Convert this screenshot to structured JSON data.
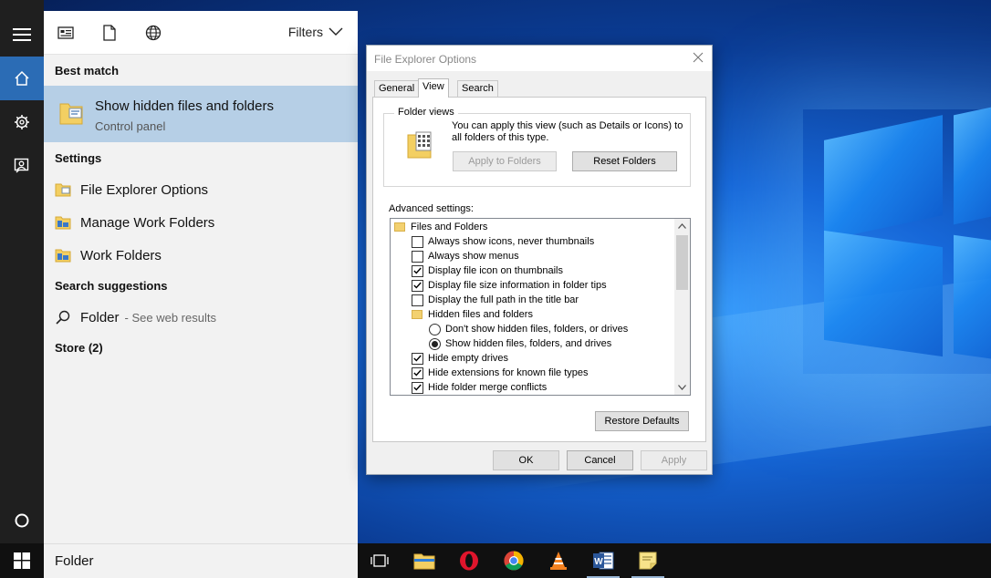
{
  "start_rail": {
    "items": [
      {
        "icon": "hamburger-menu-icon"
      },
      {
        "icon": "home-icon"
      },
      {
        "icon": "settings-gear-icon"
      },
      {
        "icon": "feedback-person-icon"
      },
      {
        "icon": "cortana-circle-icon"
      }
    ]
  },
  "search_panel": {
    "toolbar": {
      "icons": [
        "apps-icon",
        "documents-icon",
        "web-icon"
      ],
      "filters_label": "Filters"
    },
    "best_match": {
      "heading": "Best match",
      "title": "Show hidden files and folders",
      "subtitle": "Control panel"
    },
    "settings": {
      "heading": "Settings",
      "items": [
        "File Explorer Options",
        "Manage Work Folders",
        "Work Folders"
      ]
    },
    "suggestions": {
      "heading": "Search suggestions",
      "query": "Folder",
      "hint": "- See web results"
    },
    "store_heading": "Store (2)"
  },
  "taskbar": {
    "search_text": "Folder",
    "apps": [
      "task-view-icon",
      "file-explorer-icon",
      "opera-icon",
      "chrome-icon",
      "vlc-icon",
      "word-icon",
      "sticky-notes-icon"
    ]
  },
  "dialog": {
    "title": "File Explorer Options",
    "tabs": [
      "General",
      "View",
      "Search"
    ],
    "active_tab": "View",
    "folder_views": {
      "heading": "Folder views",
      "description": "You can apply this view (such as Details or Icons) to all folders of this type.",
      "apply_button": "Apply to Folders",
      "reset_button": "Reset Folders"
    },
    "advanced_label": "Advanced settings:",
    "tree": [
      {
        "type": "folder",
        "label": "Files and Folders"
      },
      {
        "type": "checkbox",
        "label": "Always show icons, never thumbnails",
        "checked": false
      },
      {
        "type": "checkbox",
        "label": "Always show menus",
        "checked": false
      },
      {
        "type": "checkbox",
        "label": "Display file icon on thumbnails",
        "checked": true
      },
      {
        "type": "checkbox",
        "label": "Display file size information in folder tips",
        "checked": true
      },
      {
        "type": "checkbox",
        "label": "Display the full path in the title bar",
        "checked": false
      },
      {
        "type": "folder",
        "label": "Hidden files and folders"
      },
      {
        "type": "radio",
        "label": "Don't show hidden files, folders, or drives",
        "checked": false
      },
      {
        "type": "radio",
        "label": "Show hidden files, folders, and drives",
        "checked": true
      },
      {
        "type": "checkbox",
        "label": "Hide empty drives",
        "checked": true
      },
      {
        "type": "checkbox",
        "label": "Hide extensions for known file types",
        "checked": true
      },
      {
        "type": "checkbox",
        "label": "Hide folder merge conflicts",
        "checked": true
      }
    ],
    "restore_button": "Restore Defaults",
    "ok_button": "OK",
    "cancel_button": "Cancel",
    "apply_button": "Apply"
  }
}
